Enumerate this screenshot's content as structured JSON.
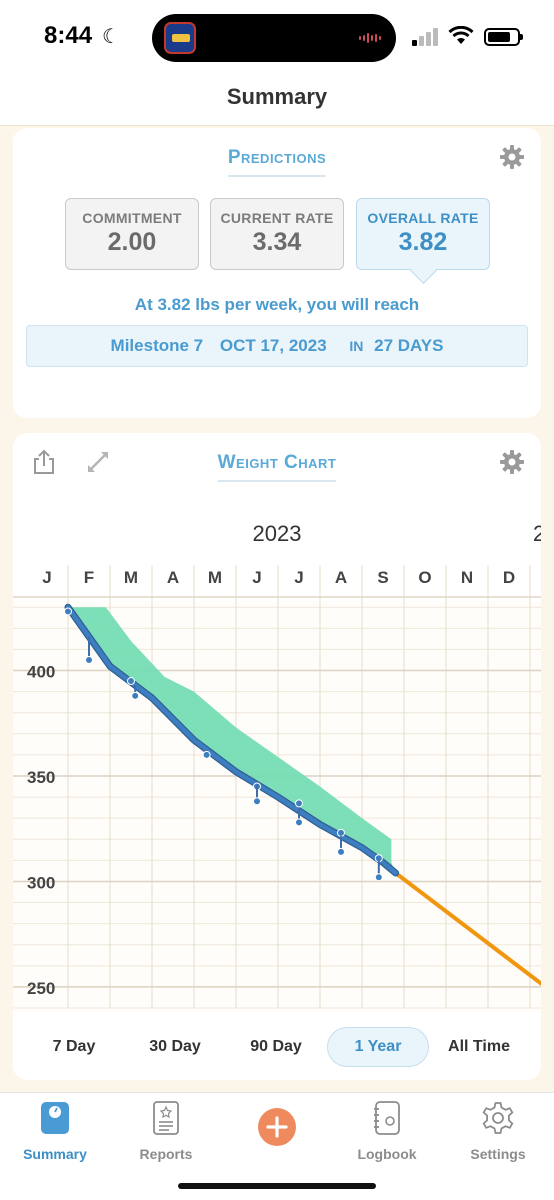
{
  "status_bar": {
    "time": "8:44"
  },
  "header": {
    "title": "Summary"
  },
  "predictions": {
    "title": "Predictions",
    "metrics": [
      {
        "label": "COMMITMENT",
        "value": "2.00"
      },
      {
        "label": "CURRENT RATE",
        "value": "3.34"
      },
      {
        "label": "OVERALL RATE",
        "value": "3.82"
      }
    ],
    "selected_metric": "OVERALL RATE",
    "reach_text": "At 3.82 lbs per week, you will reach",
    "milestone": {
      "name": "Milestone 7",
      "date": "OCT 17, 2023",
      "in_label": "IN",
      "days": "27 DAYS"
    }
  },
  "weight_chart": {
    "title": "Weight Chart",
    "ranges": [
      "7 Day",
      "30 Day",
      "90 Day",
      "1 Year",
      "All Time"
    ],
    "selected_range": "1 Year"
  },
  "chart_data": {
    "type": "line",
    "year_label": "2023",
    "next_year_label": "2",
    "month_labels": [
      "J",
      "F",
      "M",
      "A",
      "M",
      "J",
      "J",
      "A",
      "S",
      "O",
      "N",
      "D",
      "J"
    ],
    "y_ticks": [
      400,
      350,
      300,
      250
    ],
    "ylim": [
      240,
      432
    ],
    "series": [
      {
        "points": [
          [
            0.5,
            428
          ],
          [
            1.0,
            405
          ],
          [
            2.0,
            395
          ],
          [
            2.1,
            388
          ],
          [
            3.8,
            360
          ],
          [
            5.0,
            345
          ],
          [
            5.0,
            338
          ],
          [
            6.0,
            337
          ],
          [
            6.0,
            328
          ],
          [
            7.0,
            323
          ],
          [
            7.0,
            314
          ],
          [
            7.9,
            311
          ],
          [
            7.9,
            302
          ]
        ],
        "trend": [
          [
            0.5,
            430
          ],
          [
            1.5,
            402
          ],
          [
            2.5,
            387
          ],
          [
            3.5,
            367
          ],
          [
            4.5,
            352
          ],
          [
            5.5,
            340
          ],
          [
            6.5,
            327
          ],
          [
            7.5,
            316
          ],
          [
            8.0,
            309
          ],
          [
            8.3,
            304
          ]
        ]
      },
      {
        "projection": [
          [
            8.3,
            304
          ],
          [
            12.0,
            248
          ]
        ]
      }
    ],
    "band_upper": [
      [
        0.5,
        430
      ],
      [
        1.4,
        430
      ],
      [
        2.0,
        414
      ],
      [
        2.8,
        397
      ],
      [
        3.5,
        390
      ],
      [
        4.5,
        373
      ],
      [
        5.5,
        359
      ],
      [
        6.5,
        345
      ],
      [
        7.5,
        330
      ],
      [
        8.2,
        320
      ],
      [
        8.2,
        309
      ]
    ],
    "colors": {
      "trend": "#3d7ec0",
      "band": "#6fdcb0",
      "projection": "#f0960f",
      "axis_text": "#333333"
    }
  },
  "tab_bar": {
    "tabs": [
      {
        "label": "Summary",
        "icon": "scale-icon"
      },
      {
        "label": "Reports",
        "icon": "report-icon"
      },
      {
        "label": "",
        "icon": "plus-icon"
      },
      {
        "label": "Logbook",
        "icon": "logbook-icon"
      },
      {
        "label": "Settings",
        "icon": "gear-icon"
      }
    ],
    "selected": "Summary"
  }
}
